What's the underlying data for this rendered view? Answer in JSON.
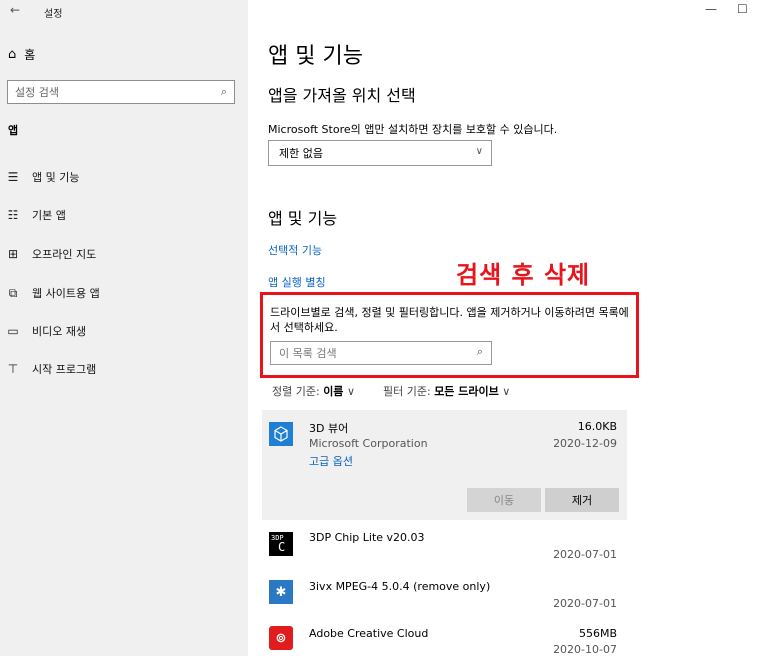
{
  "titlebar": {
    "back_glyph": "←",
    "title": "설정",
    "minimize_glyph": "—",
    "maximize_glyph": "☐"
  },
  "sidebar": {
    "home_label": "홈",
    "search_placeholder": "설정 검색",
    "section": "앱",
    "items": [
      {
        "label": "앱 및 기능",
        "icon": "apps-list-icon",
        "glyph": "☰"
      },
      {
        "label": "기본 앱",
        "icon": "default-apps-icon",
        "glyph": "☷"
      },
      {
        "label": "오프라인 지도",
        "icon": "offline-map-icon",
        "glyph": "⊞"
      },
      {
        "label": "웹 사이트용 앱",
        "icon": "website-app-icon",
        "glyph": "⧉"
      },
      {
        "label": "비디오 재생",
        "icon": "video-playback-icon",
        "glyph": "▭"
      },
      {
        "label": "시작 프로그램",
        "icon": "startup-icon",
        "glyph": "⊤"
      }
    ]
  },
  "main": {
    "title": "앱 및 기능",
    "install_heading": "앱을 가져올 위치 선택",
    "install_desc": "Microsoft Store의 앱만 설치하면 장치를 보호할 수 있습니다.",
    "install_select": "제한 없음",
    "apps_heading": "앱 및 기능",
    "optional_link": "선택적 기능",
    "alias_link": "앱 실행 별칭",
    "annotation": "검색 후 삭제",
    "filter_desc": "드라이브별로 검색, 정렬 및 필터링합니다. 앱을 제거하거나 이동하려면 목록에서 선택하세요.",
    "filter_placeholder": "이 목록 검색",
    "sort_label": "정렬 기준:",
    "sort_value": "이름",
    "filter_label": "필터 기준:",
    "filter_value": "모든 드라이브",
    "move_button": "이동",
    "remove_button": "제거"
  },
  "apps": [
    {
      "name": "3D 뷰어",
      "publisher": "Microsoft Corporation",
      "advanced": "고급 옵션",
      "size": "16.0KB",
      "date": "2020-12-09",
      "icon": "3d-viewer-icon"
    },
    {
      "name": "3DP Chip Lite v20.03",
      "size": "",
      "date": "2020-07-01",
      "icon": "3dp-chip-icon"
    },
    {
      "name": "3ivx MPEG-4 5.0.4 (remove only)",
      "size": "",
      "date": "2020-07-01",
      "icon": "3ivx-icon"
    },
    {
      "name": "Adobe Creative Cloud",
      "size": "556MB",
      "date": "2020-10-07",
      "icon": "adobe-cc-icon"
    }
  ],
  "colors": {
    "accent": "#0a64c2",
    "annotation": "#e8131b",
    "sidebar_bg": "#f0f0f0"
  }
}
